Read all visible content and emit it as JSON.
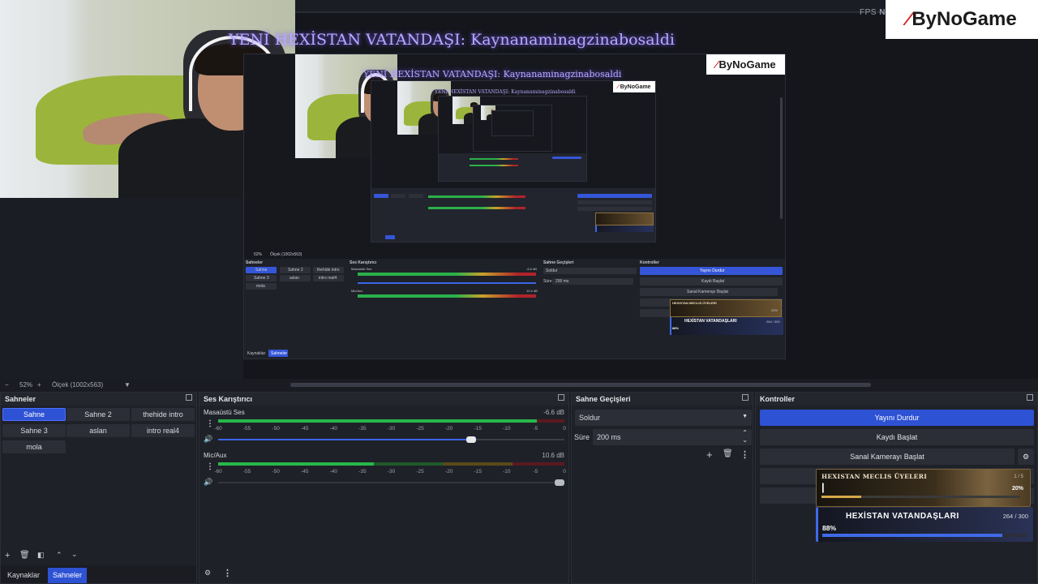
{
  "preview": {
    "fps_label": "FPS",
    "fps_extra": "N",
    "logo_text": "ByNoGame",
    "overlay_title": "YENİ HEXİSTAN VATANDAŞI: Kaynanaminagzinabosaldi",
    "nested_docks": {
      "scenes_title": "Sahneler",
      "mixer_title": "Ses Karıştırıcı",
      "transitions_title": "Sahne Geçişleri",
      "controls_title": "Kontroller",
      "scenes": [
        "Sahne",
        "Sahne 2",
        "thehide intro",
        "Sahne 3",
        "aslan",
        "intro real4",
        "mola"
      ],
      "track1": "Masaüstü Ses",
      "track1_db": "-6.6 dB",
      "track2": "Mic/Aux",
      "track2_db": "10.4 dB",
      "transition": "Soldur",
      "duration_label": "Süre",
      "duration_value": "200 ms",
      "btn_stream": "Yayını Durdur",
      "btn_record": "Kaydı Başlat",
      "btn_vcam": "Sanal Kamerayı Başlat",
      "hex1_title": "HEXISTAN MECLIS ÜYELERI",
      "hex1_pct": "20%",
      "hex2_title": "HEXİSTAN VATANDAŞLARI",
      "hex2_count": "264 / 300",
      "hex2_pct": "88%",
      "tab_sources": "Kaynaklar",
      "tab_scenes": "Sahneler",
      "zoom": "52%",
      "scale": "Ölçek (1002x563)"
    }
  },
  "statusbar": {
    "minus": "−",
    "zoom": "52%",
    "plus": "+",
    "scale": "Ölçek (1002x563)",
    "dropdown": "▼"
  },
  "scenes_dock": {
    "title": "Sahneler",
    "scenes": [
      "Sahne",
      "Sahne 2",
      "thehide intro",
      "Sahne 3",
      "aslan",
      "intro real4",
      "mola"
    ],
    "active_index": 0,
    "tabs": [
      "Kaynaklar",
      "Sahneler"
    ],
    "active_tab": 1
  },
  "mixer_dock": {
    "title": "Ses Karıştırıcı",
    "ticks": [
      "-60",
      "-55",
      "-50",
      "-45",
      "-40",
      "-35",
      "-30",
      "-25",
      "-20",
      "-15",
      "-10",
      "-5",
      "0"
    ],
    "tracks": [
      {
        "name": "Masaüstü Ses",
        "db": "-6.6 dB",
        "level": 0.92,
        "volume": 0.73
      },
      {
        "name": "Mic/Aux",
        "db": "10.6 dB",
        "level": 0.45,
        "volume": 0.0
      }
    ]
  },
  "transitions_dock": {
    "title": "Sahne Geçişleri",
    "transition": "Soldur",
    "duration_label": "Süre",
    "duration_value": "200 ms"
  },
  "controls_dock": {
    "title": "Kontroller",
    "stream_button": "Yayını Durdur",
    "record_button": "Kaydı Başlat",
    "vcam_button": "Sanal Kamerayı Başlat",
    "hex_council": {
      "title": "HEXISTAN MECLIS ÜYELERI",
      "count": "1 / 5",
      "pct": "20%",
      "progress": 0.2
    },
    "hex_citizens": {
      "title": "HEXİSTAN VATANDAŞLARI",
      "count": "264 / 300",
      "pct": "88%",
      "progress": 0.88
    }
  },
  "colors": {
    "accent": "#2e52d4",
    "background": "#1f2128",
    "overlay_text": "#b8a8ff",
    "logo_red": "#d4262b"
  }
}
